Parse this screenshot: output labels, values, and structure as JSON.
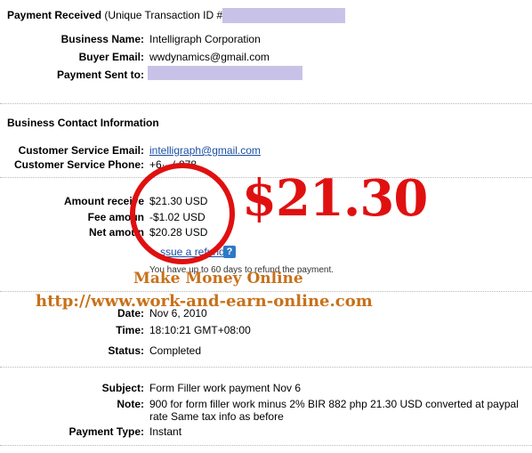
{
  "header": {
    "title": "Payment Received",
    "transaction_prefix": "(Unique Transaction ID #"
  },
  "business": {
    "name_label": "Business Name:",
    "name": "Intelligraph Corporation",
    "buyer_email_label": "Buyer Email:",
    "buyer_email": "wwdynamics@gmail.com",
    "payment_sent_label": "Payment Sent to:"
  },
  "contact": {
    "section_title": "Business Contact Information",
    "email_label": "Customer Service Email:",
    "email": "intelligraph@gmail.com",
    "phone_label": "Customer Service Phone:",
    "phone": "+6·-·/·878"
  },
  "amounts": {
    "received_label": "Amount receive",
    "received": "$21.30 USD",
    "fee_label": "Fee amoun",
    "fee": "-$1.02 USD",
    "net_label": "Net amoun",
    "net": "$20.28 USD",
    "refund_link": "ssue a refund",
    "help_glyph": "?",
    "refund_note": "You have up to 60 days to refund the payment."
  },
  "overlay": {
    "big_amount": "$21.30",
    "promo_line1": "Make Money Online",
    "promo_line2": "http://www.work-and-earn-online.com",
    "colors": {
      "red": "#e01010",
      "orange": "#c8711a"
    }
  },
  "details": {
    "date_label": "Date:",
    "date": "Nov 6, 2010",
    "time_label": "Time:",
    "time": "18:10:21 GMT+08:00",
    "status_label": "Status:",
    "status": "Completed",
    "subject_label": "Subject:",
    "subject": "Form Filler work payment Nov 6",
    "note_label": "Note:",
    "note_line1": "900 for form filler work minus 2% BIR 882 php 21.30 USD converted at paypal",
    "note_line2": "rate Same tax info as before",
    "payment_type_label": "Payment Type:",
    "payment_type": "Instant"
  }
}
